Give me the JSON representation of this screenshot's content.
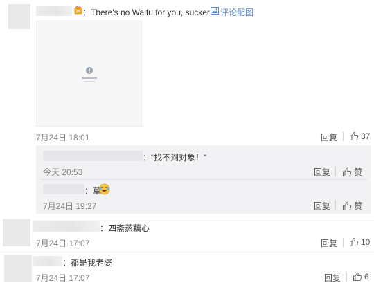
{
  "comments": [
    {
      "text": "：There's no Waifu for you, sucker.",
      "pic_link": "评论配图",
      "time": "7月24日 18:01",
      "reply": "回复",
      "likes": "37"
    },
    {
      "text": "：四斋蒸藕心",
      "time": "7月24日 17:07",
      "reply": "回复",
      "likes": "10"
    },
    {
      "text": "：都是我老婆",
      "time": "7月24日 17:07",
      "reply": "回复",
      "likes": "6"
    }
  ],
  "replies": [
    {
      "text": "：“找不到对象！”",
      "time": "今天 20:53",
      "reply": "回复",
      "like": "赞"
    },
    {
      "text": "：草",
      "time": "7月24日 19:27",
      "reply": "回复",
      "like": "赞"
    }
  ],
  "colors": {
    "link_blue": "#5a8ac6",
    "badge_orange": "#f5a623",
    "thread_bg": "#f2f2f5"
  }
}
